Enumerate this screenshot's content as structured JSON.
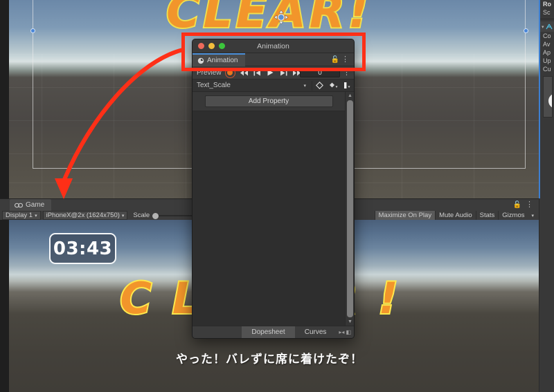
{
  "scene_view": {
    "clear_text": "CLEAR!",
    "gizmo_icon": "move-gizmo-icon",
    "colors": {
      "sky": "#7f9bb6",
      "ground": "#4b4845",
      "handle": "#4a86d8"
    }
  },
  "game_toolbar": {
    "tab_label": "Game",
    "tab_icon": "eye-icon",
    "lock_icon": "lock-icon",
    "kebab_icon": "kebab-menu-icon",
    "display_label": "Display 1",
    "resolution_label": "iPhoneX@2x (1624x750)",
    "scale_label": "Scale",
    "scale_value": 1,
    "buttons": [
      {
        "label": "Maximize On Play",
        "active": true
      },
      {
        "label": "Mute Audio",
        "active": false
      },
      {
        "label": "Stats",
        "active": false
      },
      {
        "label": "Gizmos",
        "active": false,
        "caret": "▾"
      }
    ]
  },
  "game_view": {
    "timer": "03:43",
    "clear_text": "CLEAR!",
    "subtitle": "やった！バレずに席に着けたぞ！"
  },
  "inspector": {
    "accent_color": "#3d7fd1",
    "rows": [
      {
        "label": "Ro",
        "bold": true
      },
      {
        "label": "Sc",
        "bold": false
      }
    ],
    "component_icon": "animator-icon",
    "component_triangle": "▾",
    "fields": [
      "Co",
      "Av",
      "Ap",
      "Up",
      "Cu"
    ]
  },
  "animation_window": {
    "title": "Animation",
    "traffic_lights": [
      "close-button",
      "minimize-button",
      "maximize-button"
    ],
    "tab_label": "Animation",
    "tab_icon": "clock-icon",
    "lock_icon": "lock-icon",
    "kebab_icon": "kebab-menu-icon",
    "preview_label": "Preview",
    "record_icon": "record-button-icon",
    "playback_buttons": [
      "first-frame-icon",
      "previous-keyframe-icon",
      "play-icon",
      "next-keyframe-icon",
      "last-frame-icon"
    ],
    "frame_value": "0",
    "playrow_kebab": "kebab-menu-icon",
    "clip_name": "Text_Scale",
    "clip_caret": "▾",
    "keyframe_buttons": [
      "add-keyframe-icon",
      "add-keyframe-dropdown-icon",
      "add-event-icon"
    ],
    "add_property_label": "Add Property",
    "scrollbar": {
      "up_icon": "▲",
      "down_icon": "▼"
    },
    "footer_tabs": [
      {
        "label": "Dopesheet",
        "active": true
      },
      {
        "label": "Curves",
        "active": false
      }
    ],
    "footer_icons": [
      "link-icon",
      "prev-icon",
      "next-icon"
    ]
  },
  "annotation": {
    "highlight_color": "#ff2f17",
    "arrow_icon": "curved-arrow-icon",
    "highlight_target": "animation-window-header",
    "arrow_target": "game-tab"
  }
}
